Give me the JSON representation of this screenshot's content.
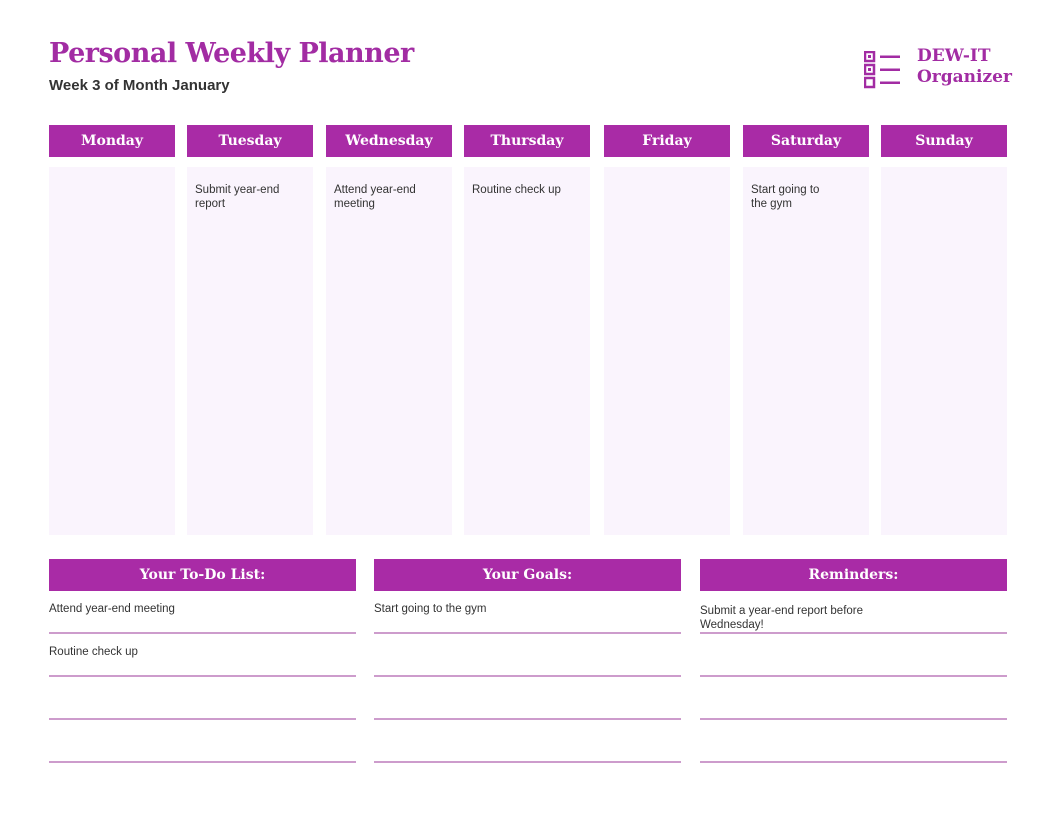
{
  "header": {
    "title": "Personal Weekly Planner",
    "subtitle": "Week 3 of Month January"
  },
  "logo": {
    "icon": "checklist-icon",
    "line1": "DEW-IT",
    "line2": "Organizer"
  },
  "colors": {
    "accent": "#a92ba6",
    "cell_background": "#faf4fd",
    "rule_line": "#cd9ccc",
    "text": "#333333"
  },
  "days": [
    {
      "label": "Monday",
      "note": ""
    },
    {
      "label": "Tuesday",
      "note": "Submit year-end report"
    },
    {
      "label": "Wednesday",
      "note": "Attend year-end meeting"
    },
    {
      "label": "Thursday",
      "note": "Routine check up"
    },
    {
      "label": "Friday",
      "note": ""
    },
    {
      "label": "Saturday",
      "note": "Start going to the gym"
    },
    {
      "label": "Sunday",
      "note": ""
    }
  ],
  "sections": {
    "todo": {
      "title": "Your To-Do List:",
      "items": [
        "Attend year-end meeting",
        "Routine check up",
        "",
        ""
      ]
    },
    "goals": {
      "title": "Your Goals:",
      "items": [
        "Start going to the gym",
        "",
        "",
        ""
      ]
    },
    "reminders": {
      "title": "Reminders:",
      "items": [
        "Submit a year-end report before Wednesday!",
        "",
        "",
        ""
      ]
    }
  }
}
